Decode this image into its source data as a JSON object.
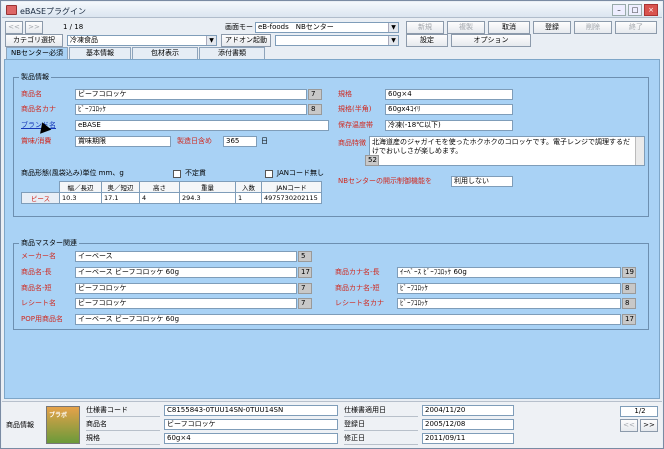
{
  "window": {
    "title": "eBASEプラグイン"
  },
  "toolbar": {
    "nav_prev": "<<",
    "nav_next": ">>",
    "record_pos": "1 / 18",
    "mode_label": "画面モード",
    "mode_value": "eB-foods　NBセンター",
    "category_label": "カテゴリ選択",
    "category_value": "冷凍食品",
    "addon_label": "アドオン起動",
    "buttons": {
      "new": "新規",
      "copy": "複製",
      "cancel": "取消",
      "register": "登録",
      "delete": "削除",
      "exit": "終了",
      "settings": "設定",
      "option": "オプション"
    }
  },
  "tabs": [
    "NBセンター必須",
    "基本情報",
    "包材表示",
    "添付書類"
  ],
  "product_info": {
    "group_title": "製品情報",
    "name_label": "商品名",
    "name_value": "ビーフコロッケ",
    "name_count": "7",
    "kana_label": "商品名カナ",
    "kana_value": "ﾋﾞｰﾌｺﾛｯｹ",
    "kana_count": "8",
    "brand_label": "ブランド名",
    "brand_value": "eBASE",
    "period_label": "賞味/消費",
    "period_value": "賞味期限",
    "days_label": "製造日含め",
    "days_value": "365",
    "days_unit": "日",
    "spec_label": "規格",
    "spec_value": "60g×4",
    "spec_half_label": "規格(半角)",
    "spec_half_value": "60gx4ｺｲﾘ",
    "storage_label": "保存温度帯",
    "storage_value": "冷凍(-18℃以下)",
    "feature_label": "商品特徴",
    "feature_value": "北海道産のジャガイモを使ったホクホクのコロッケです。電子レンジで調理するだけでおいしさが楽しめます。",
    "feature_count": "52",
    "dims_label": "商品形態(風袋込み)単位 mm、g",
    "unfixed_label": "不定貫",
    "jan_none_label": "JANコード無し",
    "dims_headers": [
      "幅／長辺",
      "奥／短辺",
      "高さ",
      "重量",
      "入数",
      "JANコード"
    ],
    "dims_row_label": "ピース",
    "dims_values": [
      "10.3",
      "17.1",
      "4",
      "294.3",
      "1",
      "4975730202115"
    ],
    "nb_disclosure_label": "NBセンターの開示制御機能を",
    "nb_disclosure_value": "利用しない"
  },
  "master": {
    "group_title": "商品マスター関連",
    "maker_label": "メーカー名",
    "maker_value": "イーベース",
    "maker_count": "5",
    "long_label": "商品名-長",
    "long_value": "イーベース ビーフコロッケ 60g",
    "long_count": "17",
    "short_label": "商品名-短",
    "short_value": "ビーフコロッケ",
    "short_count": "7",
    "receipt_label": "レシート名",
    "receipt_value": "ビーフコロッケ",
    "receipt_count": "7",
    "pop_label": "POP用商品名",
    "pop_value": "イーベース ビーフコロッケ 60g",
    "pop_count": "17",
    "kana_long_label": "商品カナ名-長",
    "kana_long_value": "ｲｰﾍﾞｰｽ ﾋﾞｰﾌｺﾛｯｹ 60g",
    "kana_long_count": "19",
    "kana_short_label": "商品カナ名-短",
    "kana_short_value": "ﾋﾞｰﾌｺﾛｯｹ",
    "kana_short_count": "8",
    "receipt_kana_label": "レシート名カナ",
    "receipt_kana_value": "ﾋﾞｰﾌｺﾛｯｹ",
    "receipt_kana_count": "8"
  },
  "footer": {
    "section_label": "商品情報",
    "spec_code_label": "仕様書コード",
    "spec_code_value": "C8155843-0TUU14SN-0TUU14SN",
    "name_label": "商品名",
    "name_value": "ビーフコロッケ",
    "spec_label": "規格",
    "spec_value": "60g×4",
    "applied_label": "仕様書適用日",
    "applied_value": "2004/11/20",
    "registered_label": "登録日",
    "registered_value": "2005/12/08",
    "modified_label": "修正日",
    "modified_value": "2011/09/11",
    "page_value": "1/2",
    "thumb_text": "ブラボ"
  }
}
